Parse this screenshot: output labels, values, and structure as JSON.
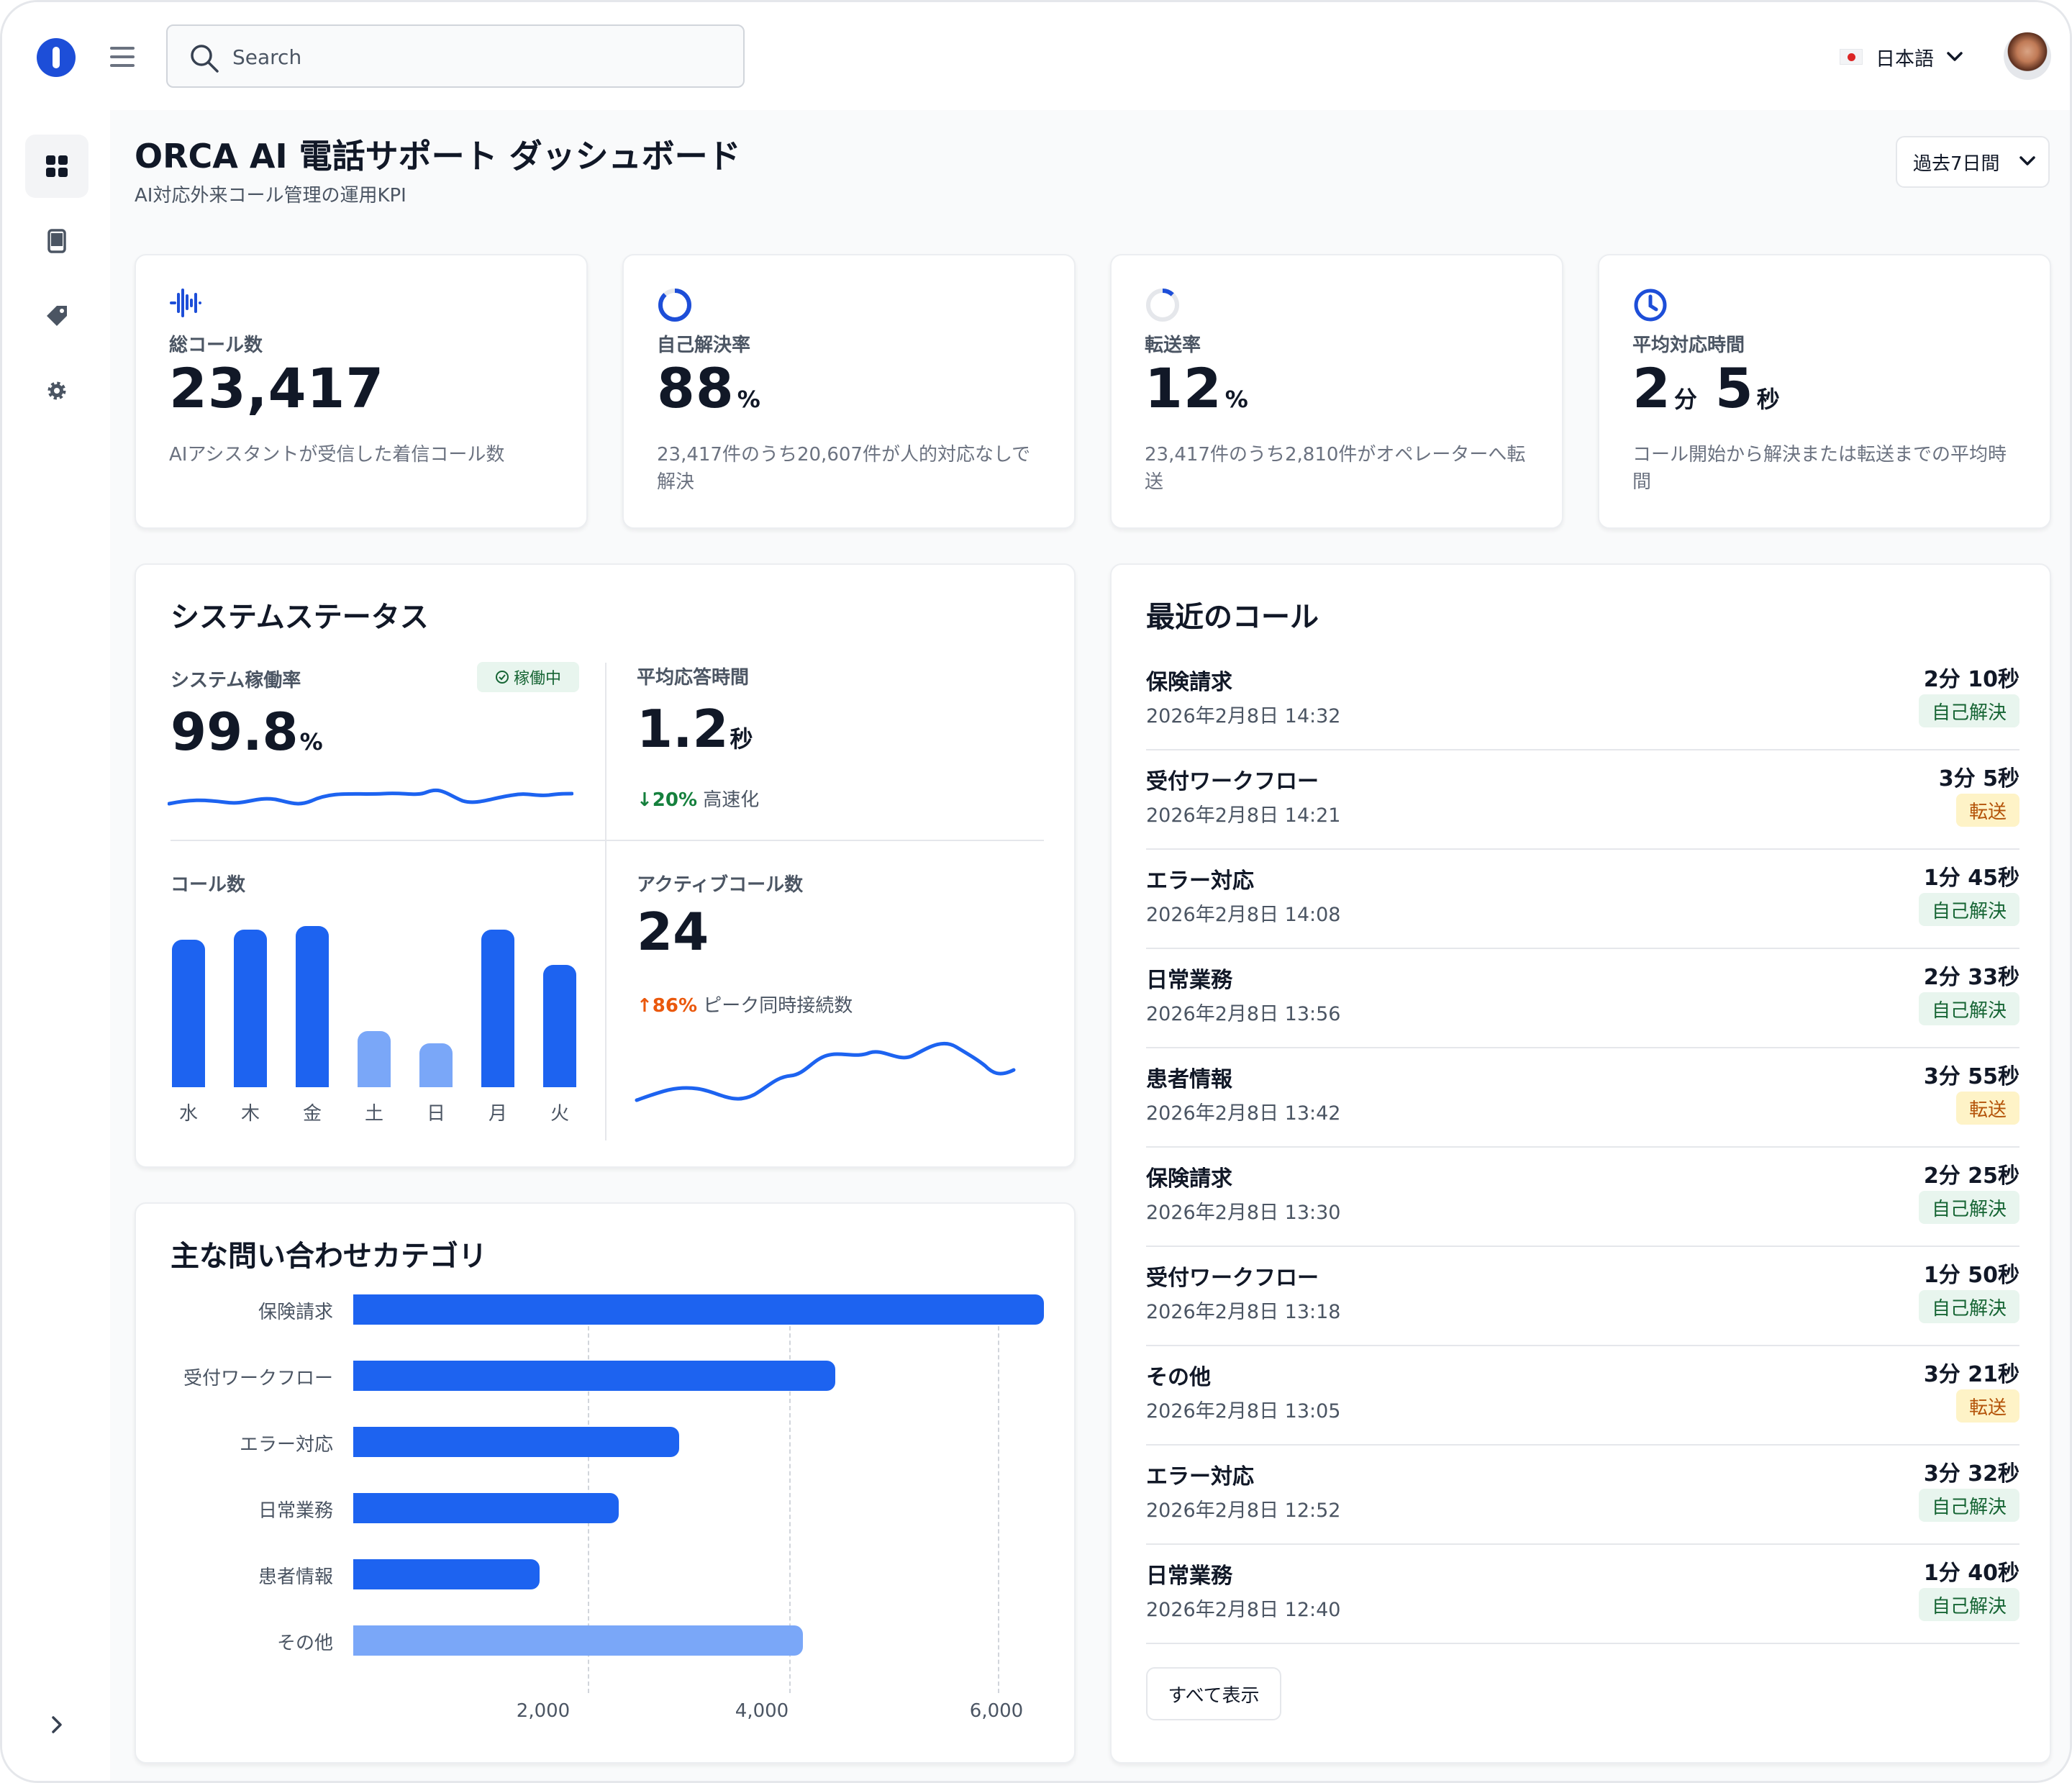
{
  "header": {
    "search_placeholder": "Search",
    "language": "日本語"
  },
  "page": {
    "title": "ORCA AI 電話サポート ダッシュボード",
    "subtitle": "AI対応外来コール管理の運用KPI",
    "range": "過去7日間"
  },
  "kpis": [
    {
      "label": "総コール数",
      "value": "23,417",
      "unit": "",
      "desc": "AIアシスタントが受信した着信コール数"
    },
    {
      "label": "自己解決率",
      "value": "88",
      "unit": "%",
      "desc": "23,417件のうち20,607件が人的対応なしで解決"
    },
    {
      "label": "転送率",
      "value": "12",
      "unit": "%",
      "desc": "23,417件のうち2,810件がオペレーターへ転送"
    },
    {
      "label": "平均対応時間",
      "v1": "2",
      "u1": "分",
      "v2": "5",
      "u2": "秒",
      "desc": "コール開始から解決または転送までの平均時間"
    }
  ],
  "status": {
    "title": "システムステータス",
    "uptime_label": "システム稼働率",
    "uptime_badge": "稼働中",
    "uptime_value": "99.8",
    "uptime_unit": "%",
    "resp_label": "平均応答時間",
    "resp_value": "1.2",
    "resp_unit": "秒",
    "resp_delta": "↓20%",
    "resp_delta_text": "高速化",
    "calls_label": "コール数",
    "active_label": "アクティブコール数",
    "active_value": "24",
    "active_delta": "↑86%",
    "active_delta_text": "ピーク同時接続数",
    "days": [
      "水",
      "木",
      "金",
      "土",
      "日",
      "月",
      "火"
    ],
    "colors": {
      "primary": "#1d63f0",
      "light": "#7aa7f8",
      "up": "#ea580c",
      "down": "#15803d"
    }
  },
  "chart_data": {
    "type": "bar",
    "title": "コール数",
    "categories": [
      "水",
      "木",
      "金",
      "土",
      "日",
      "月",
      "火"
    ],
    "values": [
      0.87,
      0.93,
      0.95,
      0.33,
      0.26,
      0.93,
      0.72
    ]
  },
  "categories_chart": {
    "title": "主な問い合わせカテゴリ",
    "type": "bar",
    "categories": [
      "保険請求",
      "受付ワークフロー",
      "エラー対応",
      "日常業務",
      "患者情報",
      "その他"
    ],
    "values": [
      6300,
      4400,
      2970,
      2420,
      1700,
      4100
    ],
    "ticks": [
      "2,000",
      "4,000",
      "6,000"
    ]
  },
  "recent": {
    "title": "最近のコール",
    "show_all": "すべて表示",
    "rows": [
      {
        "name": "保険請求",
        "time": "2026年2月8日 14:32",
        "dur": "2分 10秒",
        "status": "自己解決",
        "kind": "ok"
      },
      {
        "name": "受付ワークフロー",
        "time": "2026年2月8日 14:21",
        "dur": "3分 5秒",
        "status": "転送",
        "kind": "tr"
      },
      {
        "name": "エラー対応",
        "time": "2026年2月8日 14:08",
        "dur": "1分 45秒",
        "status": "自己解決",
        "kind": "ok"
      },
      {
        "name": "日常業務",
        "time": "2026年2月8日 13:56",
        "dur": "2分 33秒",
        "status": "自己解決",
        "kind": "ok"
      },
      {
        "name": "患者情報",
        "time": "2026年2月8日 13:42",
        "dur": "3分 55秒",
        "status": "転送",
        "kind": "tr"
      },
      {
        "name": "保険請求",
        "time": "2026年2月8日 13:30",
        "dur": "2分 25秒",
        "status": "自己解決",
        "kind": "ok"
      },
      {
        "name": "受付ワークフロー",
        "time": "2026年2月8日 13:18",
        "dur": "1分 50秒",
        "status": "自己解決",
        "kind": "ok"
      },
      {
        "name": "その他",
        "time": "2026年2月8日 13:05",
        "dur": "3分 21秒",
        "status": "転送",
        "kind": "tr"
      },
      {
        "name": "エラー対応",
        "time": "2026年2月8日 12:52",
        "dur": "3分 32秒",
        "status": "自己解決",
        "kind": "ok"
      },
      {
        "name": "日常業務",
        "time": "2026年2月8日 12:40",
        "dur": "1分 40秒",
        "status": "自己解決",
        "kind": "ok"
      }
    ]
  }
}
